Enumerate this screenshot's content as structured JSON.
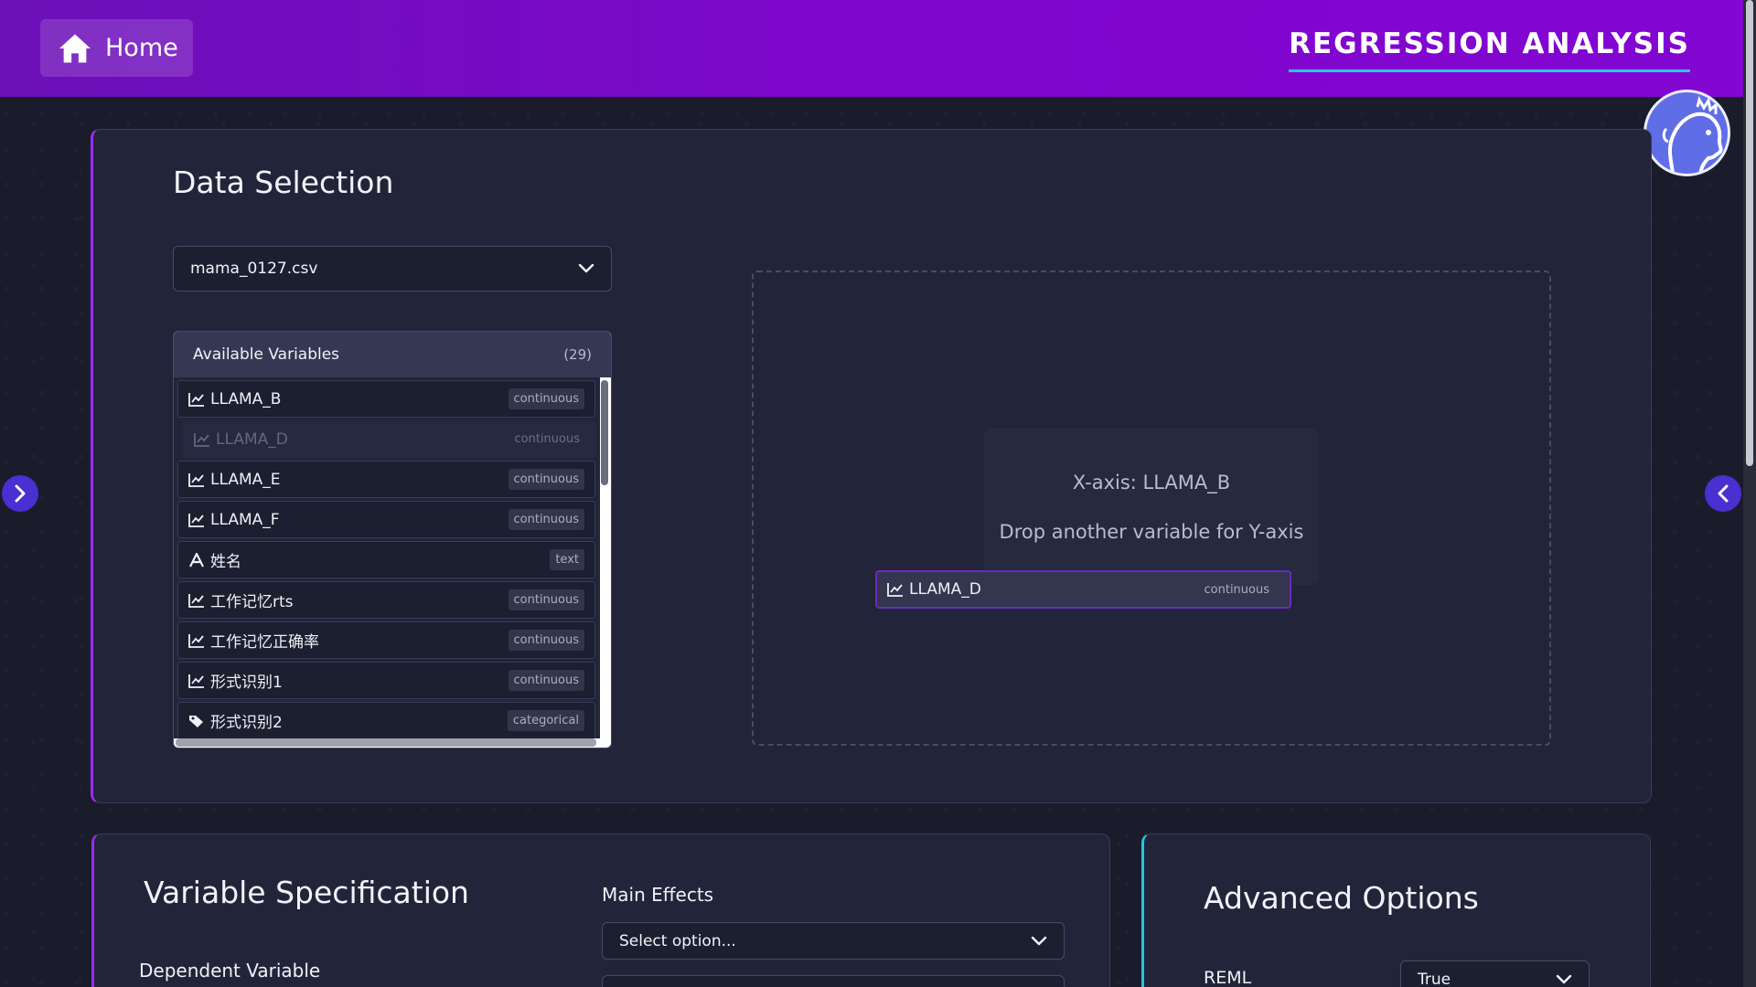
{
  "header": {
    "home_label": "Home",
    "page_title": "REGRESSION ANALYSIS"
  },
  "data_selection": {
    "title": "Data Selection",
    "file_select_value": "mama_0127.csv",
    "variables_panel": {
      "label": "Available Variables",
      "count": "(29)",
      "items": [
        {
          "name": "LLAMA_B",
          "type": "continuous",
          "icon": "line-chart-icon"
        },
        {
          "name": "LLAMA_D",
          "type": "continuous",
          "icon": "line-chart-icon"
        },
        {
          "name": "LLAMA_E",
          "type": "continuous",
          "icon": "line-chart-icon"
        },
        {
          "name": "LLAMA_F",
          "type": "continuous",
          "icon": "line-chart-icon"
        },
        {
          "name": "姓名",
          "type": "text",
          "icon": "text-icon"
        },
        {
          "name": "工作记忆rts",
          "type": "continuous",
          "icon": "line-chart-icon"
        },
        {
          "name": "工作记忆正确率",
          "type": "continuous",
          "icon": "line-chart-icon"
        },
        {
          "name": "形式识别1",
          "type": "continuous",
          "icon": "line-chart-icon"
        },
        {
          "name": "形式识别2",
          "type": "categorical",
          "icon": "tag-icon"
        }
      ]
    },
    "drop_zone": {
      "x_axis_text": "X-axis: LLAMA_B",
      "y_hint_text": "Drop another variable for Y-axis"
    },
    "drag_ghost": {
      "name": "LLAMA_D",
      "type": "continuous"
    }
  },
  "variable_spec": {
    "title": "Variable Specification",
    "main_effects_label": "Main Effects",
    "main_effects_placeholder": "Select option...",
    "dependent_label": "Dependent Variable"
  },
  "advanced": {
    "title": "Advanced Options",
    "reml_label": "REML",
    "reml_value": "True"
  },
  "colors": {
    "header_gradient_start": "#6c10b8",
    "header_gradient_end": "#8306d2",
    "accent_purple": "#9b2cf0",
    "accent_cyan": "#27c6d6",
    "side_arrow": "#4a2fd1"
  }
}
